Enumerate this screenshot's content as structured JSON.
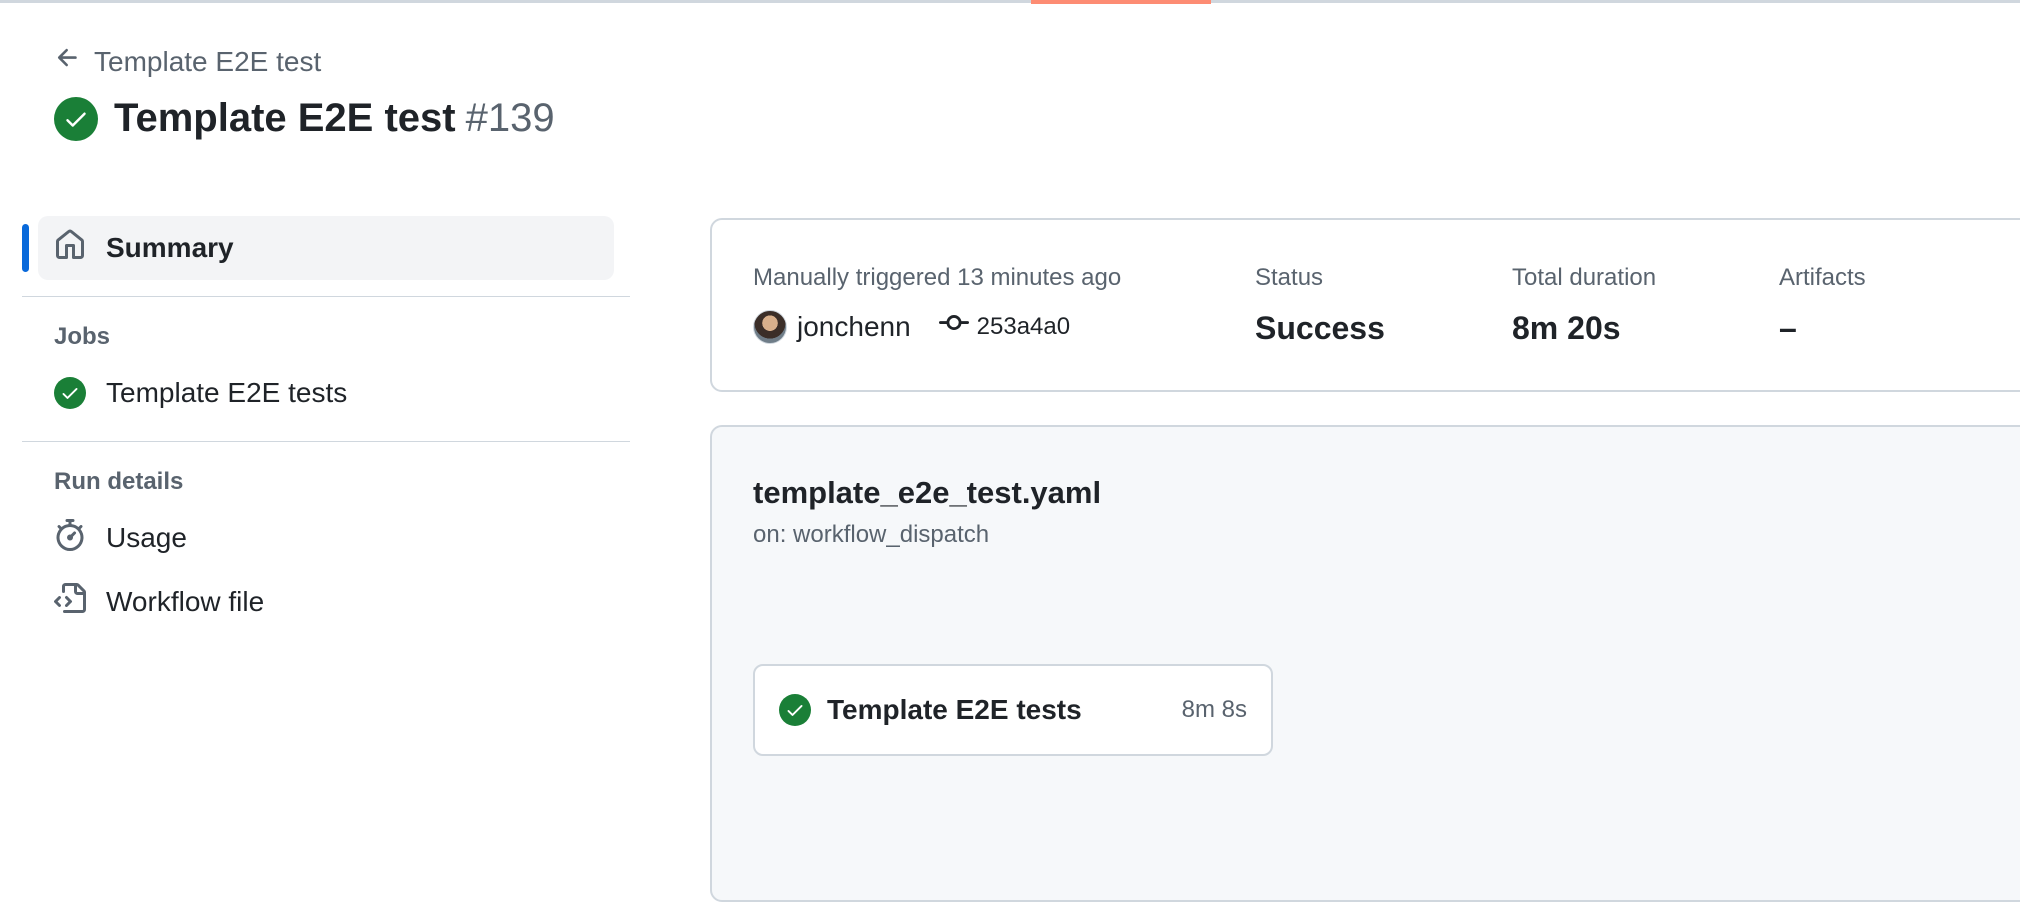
{
  "header": {
    "back_label": "Template E2E test",
    "title": "Template E2E test",
    "run_number": "#139",
    "status": "success",
    "accent_color": "#1a7f37"
  },
  "sidebar": {
    "summary_label": "Summary",
    "jobs_heading": "Jobs",
    "jobs": [
      {
        "label": "Template E2E tests",
        "status": "success"
      }
    ],
    "run_details_heading": "Run details",
    "run_details": [
      {
        "label": "Usage",
        "icon": "stopwatch-icon"
      },
      {
        "label": "Workflow file",
        "icon": "file-code-icon"
      }
    ]
  },
  "summary": {
    "trigger_text": "Manually triggered 13 minutes ago",
    "actor": "jonchenn",
    "commit": "253a4a0",
    "status_label": "Status",
    "status_value": "Success",
    "duration_label": "Total duration",
    "duration_value": "8m 20s",
    "artifacts_label": "Artifacts",
    "artifacts_value": "–"
  },
  "workflow": {
    "file_name": "template_e2e_test.yaml",
    "trigger": "on: workflow_dispatch",
    "job": {
      "name": "Template E2E tests",
      "duration": "8m 8s",
      "status": "success"
    }
  }
}
